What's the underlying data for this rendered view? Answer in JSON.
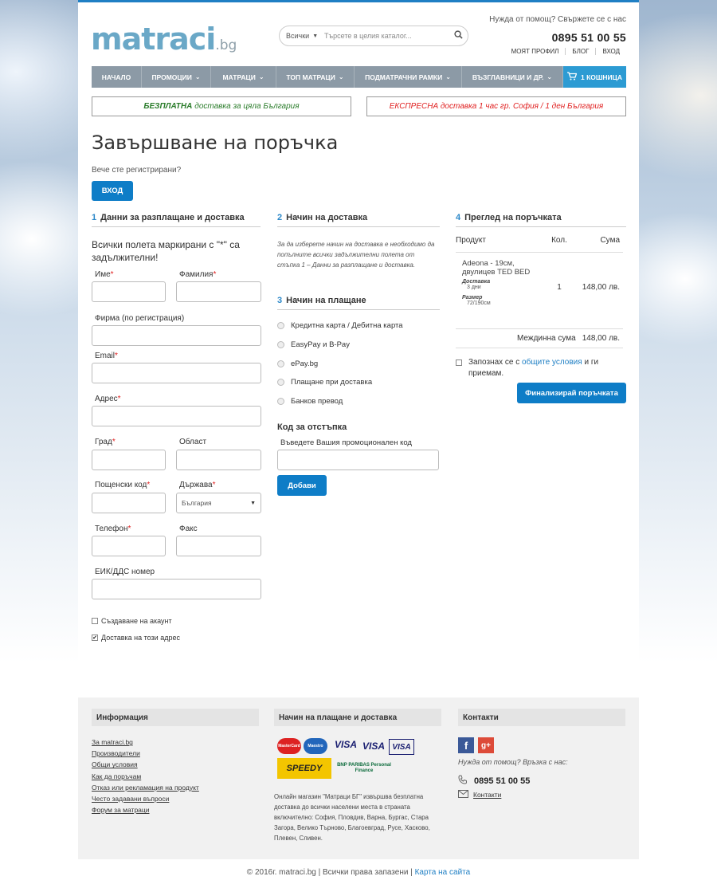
{
  "header": {
    "logo_main": "matraci",
    "logo_tld": ".bg",
    "search_category": "Всички",
    "search_placeholder": "Търсете в целия каталог...",
    "help_text": "Нужда от помощ? Свържете се с нас",
    "phone": "0895 51 00 55",
    "links": [
      "МОЯТ ПРОФИЛ",
      "БЛОГ",
      "ВХОД"
    ]
  },
  "nav": {
    "items": [
      "НАЧАЛО",
      "ПРОМОЦИИ",
      "МАТРАЦИ",
      "ТОП МАТРАЦИ",
      "ПОДМАТРАЧНИ РАМКИ",
      "ВЪЗГЛАВНИЦИ И ДР."
    ],
    "cart": "1 КОШНИЦА"
  },
  "banners": {
    "free_bold": "БЕЗПЛАТНА",
    "free_rest": "доставка за цяла България",
    "express": "ЕКСПРЕСНА доставка 1 час гр. София / 1 ден България"
  },
  "page": {
    "title": "Завършване на поръчка",
    "registered": "Вече сте регистрирани?",
    "login_button": "ВХОД"
  },
  "billing": {
    "number": "1",
    "heading": "Данни за разплащане и доставка",
    "required_note": "Всички полета маркирани с \"*\" са задължителни!",
    "first_name": "Име",
    "last_name": "Фамилия",
    "company": "Фирма (по регистрация)",
    "email": "Email",
    "address": "Адрес",
    "city": "Град",
    "region": "Област",
    "postcode": "Пощенски код",
    "country": "Държава",
    "country_value": "България",
    "phone": "Телефон",
    "fax": "Факс",
    "vat": "ЕИК/ДДС номер",
    "create_account": "Създаване на акаунт",
    "ship_to_address": "Доставка на този адрес",
    "required_mark": "*"
  },
  "delivery": {
    "number": "2",
    "heading": "Начин на доставка",
    "note": "За да изберете начин на доставка е необходимо да попълните всички задължителни полета от стъпка 1 – Данни за разплащане и доставка."
  },
  "payment": {
    "number": "3",
    "heading": "Начин на плащане",
    "options": [
      "Кредитна карта / Дебитна карта",
      "EasyPay и B-Pay",
      "ePay.bg",
      "Плащане при доставка",
      "Банков превод"
    ],
    "discount_title": "Код за отстъпка",
    "discount_label": "Въведете Вашия промоционален код",
    "add_button": "Добави"
  },
  "review": {
    "number": "4",
    "heading": "Преглед на поръчката",
    "col_product": "Продукт",
    "col_qty": "Кол.",
    "col_sum": "Сума",
    "product_name": "Adeona - 19см, двулицев TED BED",
    "attr1_name": "Доставка",
    "attr1_value": "3 дни",
    "attr2_name": "Размер",
    "attr2_value": "72/190см",
    "qty": "1",
    "price": "148,00 лв.",
    "subtotal_label": "Междинна сума",
    "subtotal_value": "148,00 лв.",
    "terms_pre": "Запознах се с",
    "terms_link": "общите условия",
    "terms_post": "и ги приемам.",
    "finalize_button": "Финализирай поръчката"
  },
  "footer": {
    "info_title": "Информация",
    "info_links": [
      "За matraci.bg",
      "Производители",
      "Общи условия",
      "Как да поръчам",
      "Отказ или рекламация на продукт",
      "Често задавани въпроси",
      "Форум за матраци"
    ],
    "pay_title": "Начин на плащане и доставка",
    "pay_logos": [
      "MasterCard",
      "Maestro",
      "VISA",
      "VISA",
      "VISA",
      "SPEEDY",
      "BNP PARIBAS Personal Finance"
    ],
    "pay_text": "Онлайн магазин \"Матраци БГ\" извършва безплатна доставка до всички населени места в страната включително: София, Пловдив, Варна, Бургас, Стара Загора, Велико Търново, Благоевград, Русе, Хасково, Плевен, Сливен.",
    "contacts_title": "Контакти",
    "help": "Нужда от помощ? Връзка с нас:",
    "phone": "0895 51 00 55",
    "contacts_link": "Контакти",
    "copyright": "© 2016г. matraci.bg | Всички права запазени |",
    "sitemap": "Карта на сайта"
  }
}
